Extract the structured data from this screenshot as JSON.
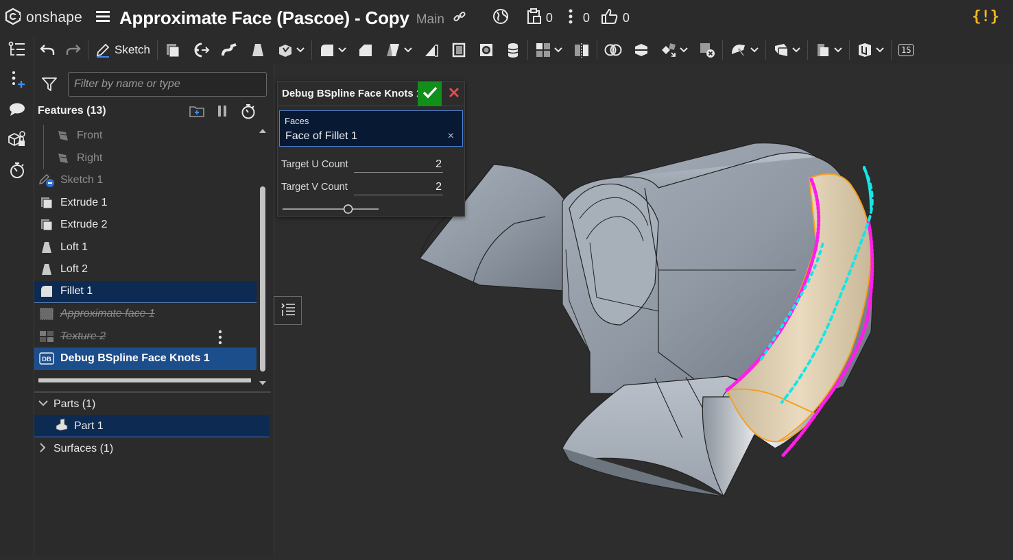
{
  "app": {
    "logo_text": "onshape",
    "document_title": "Approximate Face (Pascoe) - Copy",
    "branch": "Main",
    "counts": {
      "versions": "0",
      "comments": "0",
      "likes": "0"
    },
    "warning_label": "{!}"
  },
  "toolbar": {
    "sketch_label": "Sketch",
    "view_label": "1S"
  },
  "search": {
    "placeholder": "Filter by name or type"
  },
  "features": {
    "title": "Features (13)",
    "items": [
      {
        "label": "Front",
        "state": "dim"
      },
      {
        "label": "Right",
        "state": "dim"
      },
      {
        "label": "Sketch 1",
        "state": "dim"
      },
      {
        "label": "Extrude 1",
        "state": "normal"
      },
      {
        "label": "Extrude 2",
        "state": "normal"
      },
      {
        "label": "Loft 1",
        "state": "normal"
      },
      {
        "label": "Loft 2",
        "state": "normal"
      },
      {
        "label": "Fillet 1",
        "state": "selected"
      },
      {
        "label": "Approximate face 1",
        "state": "suppressed"
      },
      {
        "label": "Texture 2",
        "state": "suppressed"
      },
      {
        "label": "Debug BSpline Face Knots 1",
        "state": "active"
      }
    ]
  },
  "parts": {
    "parts_label": "Parts (1)",
    "part_item": "Part 1",
    "surfaces_label": "Surfaces (1)"
  },
  "dialog": {
    "title": "Debug BSpline Face Knots 1",
    "faces_label": "Faces",
    "faces_value": "Face of Fillet 1",
    "clear_glyph": "×",
    "u_label": "Target U Count",
    "u_value": "2",
    "v_label": "Target V Count",
    "v_value": "2",
    "slider_value": 0.7
  },
  "colors": {
    "accent_selected": "#0d2a52",
    "accent_active": "#1d4e8c",
    "ok_green": "#118f1b",
    "cancel_red": "#e84c4c",
    "knot_magenta": "#ff1ee8",
    "knot_cyan": "#14e6e6",
    "face_highlight": "#e8d0a8",
    "edge_orange": "#f5a020",
    "warning_yellow": "#f3b421"
  }
}
